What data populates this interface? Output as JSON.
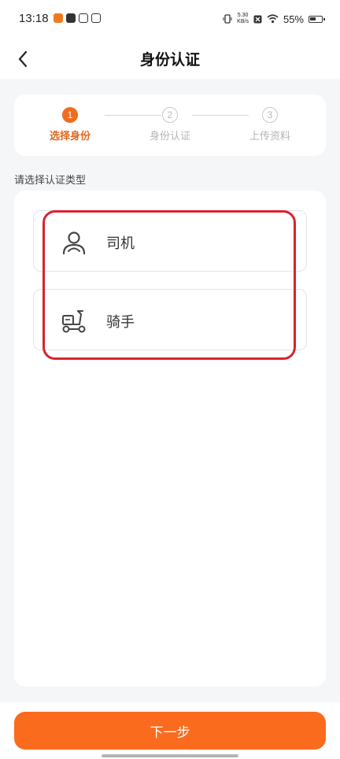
{
  "status_bar": {
    "time": "13:18",
    "net_speed_value": "5.30",
    "net_speed_unit": "KB/s",
    "battery": "55%"
  },
  "header": {
    "title": "身份认证"
  },
  "steps": [
    {
      "number": "1",
      "label": "选择身份"
    },
    {
      "number": "2",
      "label": "身份认证"
    },
    {
      "number": "3",
      "label": "上传资料"
    }
  ],
  "section_label": "请选择认证类型",
  "options": [
    {
      "label": "司机",
      "icon": "driver-person-icon"
    },
    {
      "label": "骑手",
      "icon": "rider-scooter-icon"
    }
  ],
  "next_button_label": "下一步",
  "colors": {
    "accent": "#fb6b1d",
    "highlight": "#d9232f"
  }
}
